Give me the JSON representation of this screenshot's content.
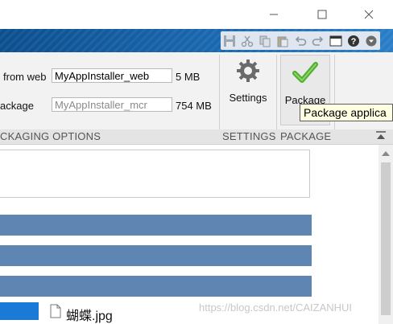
{
  "window": {
    "minimize_icon": "minimize-icon",
    "maximize_icon": "maximize-icon",
    "close_icon": "close-icon"
  },
  "quick_access": {
    "icons": [
      "save-icon",
      "cut-icon",
      "copy-icon",
      "paste-icon",
      "undo-icon",
      "redo-icon",
      "window-layout-icon",
      "help-icon",
      "dropdown-icon"
    ]
  },
  "packaging_options": {
    "web_label": "from web",
    "web_value": "MyAppInstaller_web",
    "web_size": "5 MB",
    "package_label": "ackage",
    "package_placeholder": "MyAppInstaller_mcr",
    "package_size": "754 MB",
    "group_label": "CKAGING OPTIONS"
  },
  "settings": {
    "button_label": "Settings",
    "group_label": "SETTINGS"
  },
  "package": {
    "button_label": "Package",
    "group_label": "PACKAGE",
    "tooltip": "Package applica"
  },
  "content": {
    "file_name": "蝴蝶.jpg",
    "watermark": "https://blog.csdn.net/CAIZANHUI"
  },
  "colors": {
    "accent_blue": "#5f86b3",
    "selection_blue": "#1a7ad6",
    "ribbon_bg": "#f2f2f2"
  }
}
